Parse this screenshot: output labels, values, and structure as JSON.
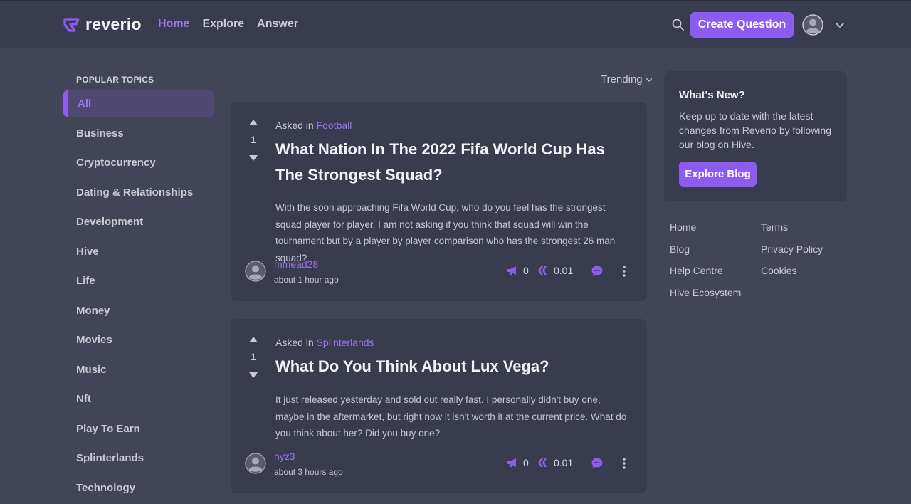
{
  "header": {
    "logo_text": "reverio",
    "nav": [
      {
        "label": "Home",
        "active": true
      },
      {
        "label": "Explore",
        "active": false
      },
      {
        "label": "Answer",
        "active": false
      }
    ],
    "create_button": "Create Question"
  },
  "sidebar": {
    "heading": "POPULAR TOPICS",
    "topics": [
      "All",
      "Business",
      "Cryptocurrency",
      "Dating & Relationships",
      "Development",
      "Hive",
      "Life",
      "Money",
      "Movies",
      "Music",
      "Nft",
      "Play To Earn",
      "Splinterlands",
      "Technology"
    ],
    "active_topic": "All"
  },
  "feed": {
    "sort_label": "Trending",
    "questions": [
      {
        "votes": "1",
        "asked_prefix": "Asked in",
        "category": "Football",
        "title": "What Nation In The 2022 Fifa World Cup Has The Strongest Squad?",
        "body": "With the soon approaching Fifa World Cup, who do you feel has the strongest squad player for player, I am not asking if you think that squad will win the tournament but by a player by player comparison who has the strongest 26 man squad?",
        "author": "mmead28",
        "time": "about 1 hour ago",
        "promote_count": "0",
        "reward": "0.01"
      },
      {
        "votes": "1",
        "asked_prefix": "Asked in",
        "category": "Splinterlands",
        "title": "What Do You Think About Lux Vega?",
        "body": "It just released yesterday and sold out really fast. I personally didn't buy one, maybe in the aftermarket, but right now it isn't worth it at the current price. What do you think about her? Did you buy one?",
        "author": "nyz3",
        "time": "about 3 hours ago",
        "promote_count": "0",
        "reward": "0.01"
      }
    ]
  },
  "whats_new": {
    "title": "What's New?",
    "text": "Keep up to date with the latest changes from Reverio by following our blog on Hive.",
    "button": "Explore Blog"
  },
  "footer_links": {
    "col1": [
      "Home",
      "Blog",
      "Help Centre",
      "Hive Ecosystem"
    ],
    "col2": [
      "Terms",
      "Privacy Policy",
      "Cookies"
    ]
  },
  "colors": {
    "accent": "#8c5cf0",
    "background": "#424458",
    "card": "#393b4e"
  }
}
